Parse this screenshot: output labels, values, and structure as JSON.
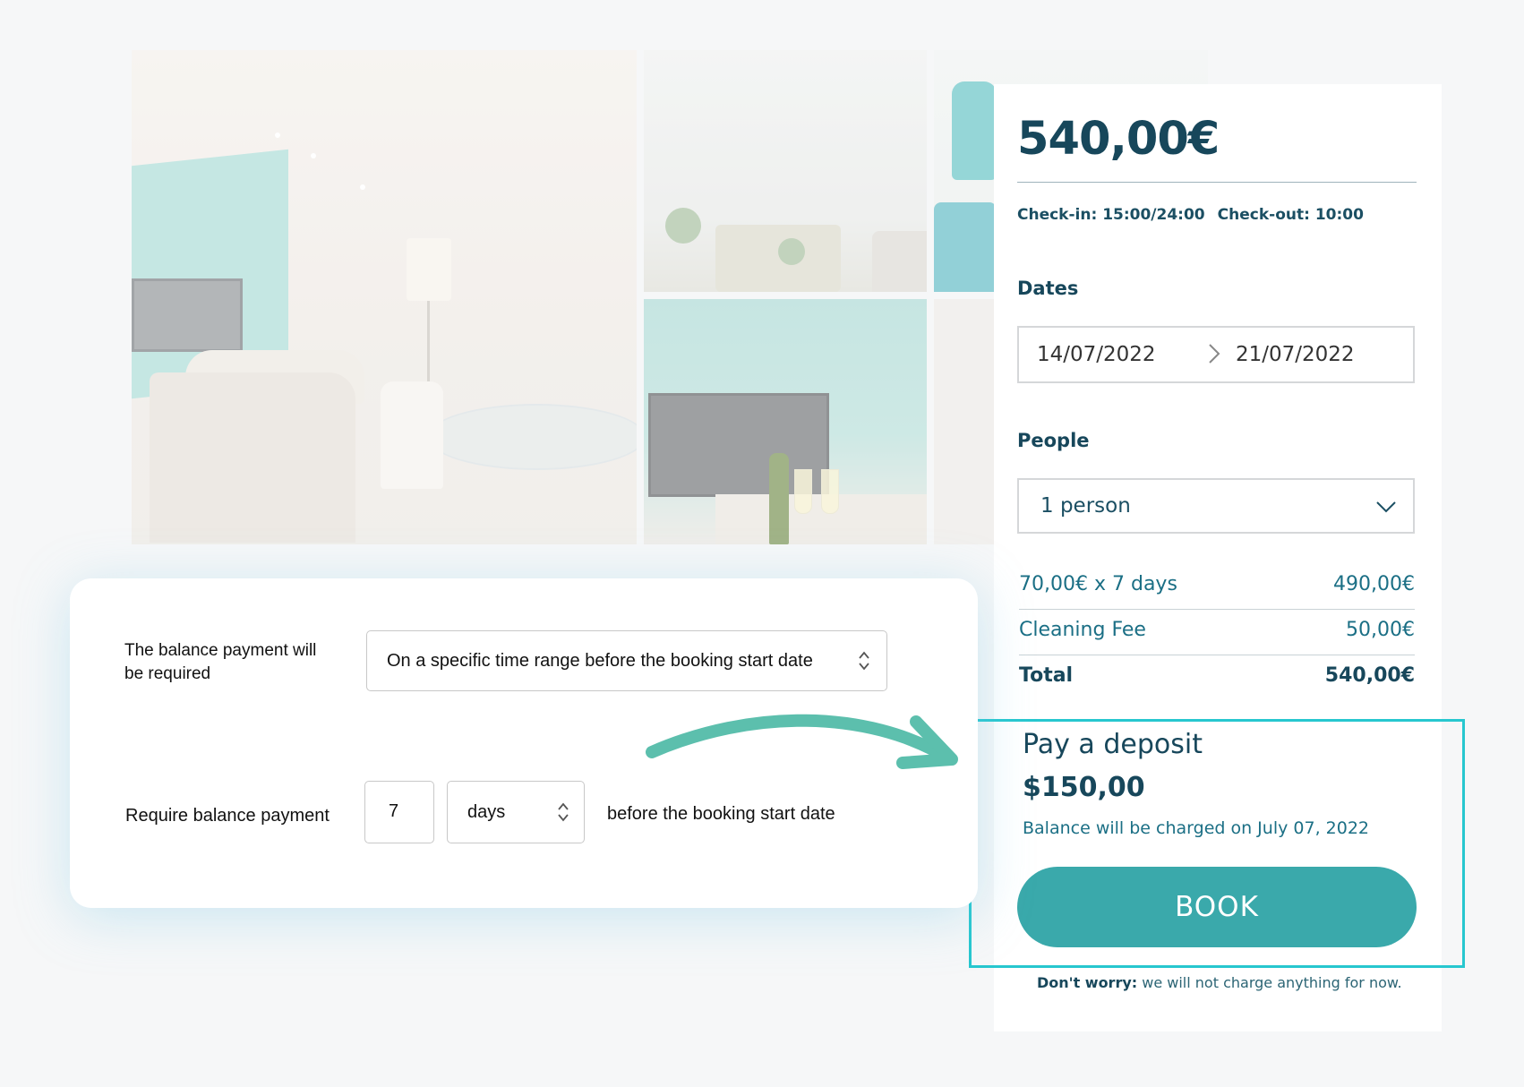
{
  "listing": {
    "price": "540,00€",
    "checkin": "Check-in: 15:00/24:00",
    "checkout": "Check-out: 10:00",
    "dates_label": "Dates",
    "date_from": "14/07/2022",
    "date_to": "21/07/2022",
    "people_label": "People",
    "people_value": "1 person",
    "lines": [
      {
        "label": "70,00€ x 7 days",
        "amount": "490,00€"
      },
      {
        "label": "Cleaning Fee",
        "amount": "50,00€"
      },
      {
        "label": "Total",
        "amount": "540,00€"
      }
    ],
    "deposit_title": "Pay a deposit",
    "deposit_amount": "$150,00",
    "balance_note": "Balance will be charged on July 07, 2022",
    "book_label": "BOOK",
    "reassure_bold": "Don't worry:",
    "reassure_text": " we will not charge anything for now."
  },
  "settings": {
    "balance_required_label": "The balance payment will be required",
    "balance_required_value": "On a specific time range before the booking start date",
    "require_label": "Require balance payment",
    "require_number": "7",
    "require_unit": "days",
    "require_suffix": "before the booking start date"
  },
  "colors": {
    "brand_dark": "#17475b",
    "accent_teal": "#3aa9ab",
    "highlight": "#27c7cf",
    "arrow": "#5cbfad"
  }
}
